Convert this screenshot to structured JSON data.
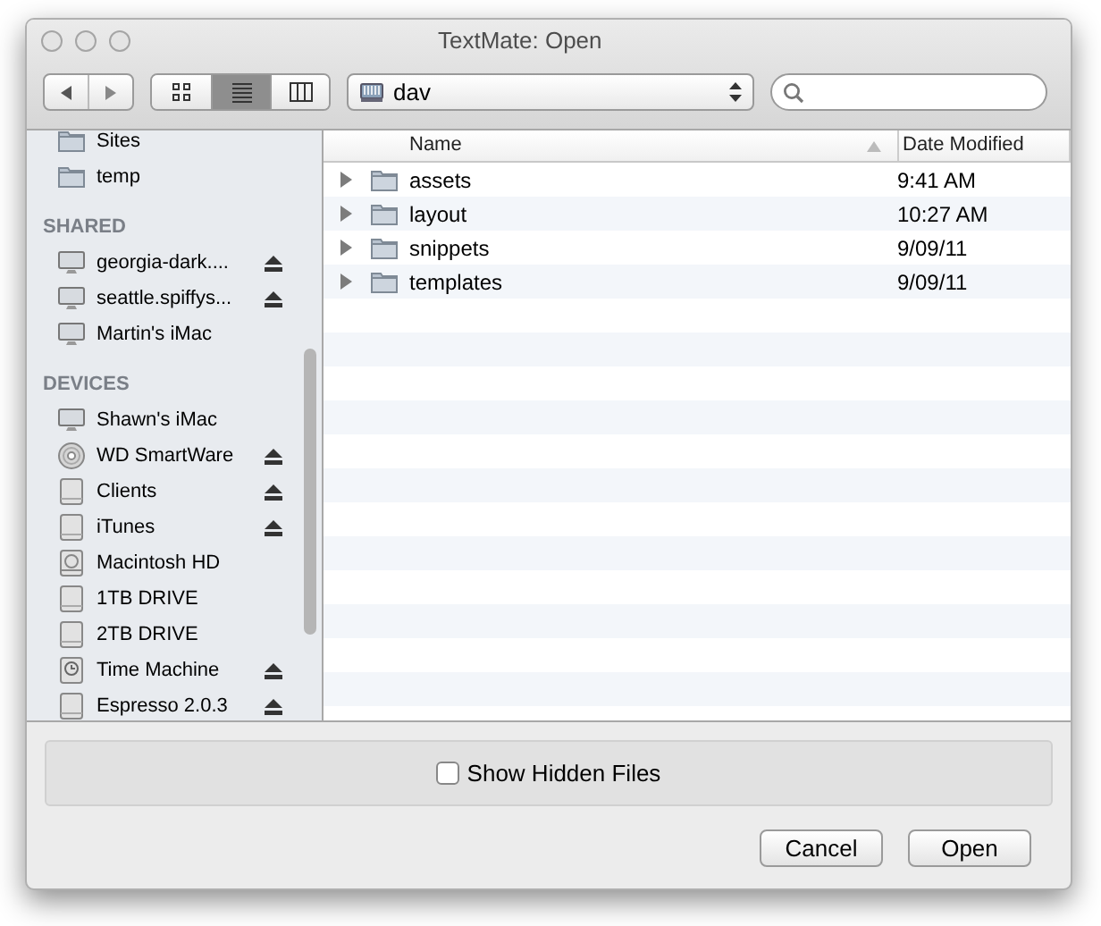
{
  "window": {
    "title": "TextMate: Open"
  },
  "toolbar": {
    "view_modes": [
      {
        "kind": "icons",
        "selected": false
      },
      {
        "kind": "list",
        "selected": true
      },
      {
        "kind": "columns",
        "selected": false
      }
    ],
    "location": "dav"
  },
  "sidebar": {
    "sections": [
      {
        "items": [
          {
            "label": "Sites",
            "kind": "folder",
            "eject": false
          },
          {
            "label": "temp",
            "kind": "folder",
            "eject": false
          }
        ]
      },
      {
        "heading": "SHARED",
        "items": [
          {
            "label": "georgia-dark....",
            "kind": "computer",
            "eject": true
          },
          {
            "label": "seattle.spiffys...",
            "kind": "computer",
            "eject": true
          },
          {
            "label": "Martin's iMac",
            "kind": "computer",
            "eject": false
          }
        ]
      },
      {
        "heading": "DEVICES",
        "items": [
          {
            "label": "Shawn's iMac",
            "kind": "computer",
            "eject": false
          },
          {
            "label": "WD SmartWare",
            "kind": "disc",
            "eject": true
          },
          {
            "label": "Clients",
            "kind": "drive",
            "eject": true
          },
          {
            "label": "iTunes",
            "kind": "drive",
            "eject": true
          },
          {
            "label": "Macintosh HD",
            "kind": "harddisk",
            "eject": false
          },
          {
            "label": "1TB DRIVE",
            "kind": "drive",
            "eject": false
          },
          {
            "label": "2TB DRIVE",
            "kind": "drive",
            "eject": false
          },
          {
            "label": "Time Machine",
            "kind": "timemachine",
            "eject": true
          },
          {
            "label": "Espresso 2.0.3",
            "kind": "drive",
            "eject": true
          }
        ]
      }
    ]
  },
  "table": {
    "columns": [
      "Name",
      "Date Modified"
    ],
    "rows": [
      {
        "name": "assets",
        "date": "9:41 AM",
        "expanded": false
      },
      {
        "name": "layout",
        "date": "10:27 AM",
        "expanded": false
      },
      {
        "name": "snippets",
        "date": "9/09/11",
        "expanded": false
      },
      {
        "name": "templates",
        "date": "9/09/11",
        "expanded": false
      }
    ]
  },
  "options": {
    "show_hidden_files": {
      "label": "Show Hidden Files",
      "checked": false
    }
  },
  "buttons": [
    "Cancel",
    "Open"
  ]
}
